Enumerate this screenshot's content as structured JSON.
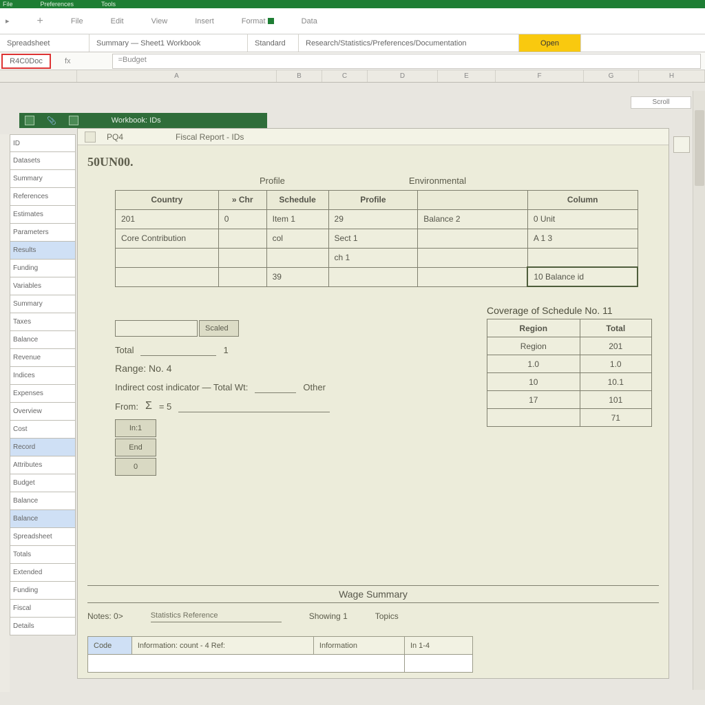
{
  "appbar": {
    "items": [
      "File",
      "Preferences",
      "Tools"
    ]
  },
  "menu": {
    "items": [
      "",
      "File",
      "Edit",
      "View",
      "Insert",
      "Format",
      "Data"
    ]
  },
  "tabs": {
    "items": [
      "Spreadsheet",
      "Summary — Sheet1   Workbook",
      "Standard",
      "Research/Statistics/Preferences/Documentation"
    ],
    "highlight": "Open"
  },
  "refbar": {
    "cell": "R4C0Doc",
    "formula": "=Budget"
  },
  "corner_label": "Scroll",
  "greenbar": {
    "title": "Workbook: IDs"
  },
  "sidebar": {
    "items": [
      {
        "label": "ID",
        "sel": false
      },
      {
        "label": "Datasets",
        "sel": false
      },
      {
        "label": "Summary",
        "sel": false
      },
      {
        "label": "References",
        "sel": false
      },
      {
        "label": "Estimates",
        "sel": false
      },
      {
        "label": "Parameters",
        "sel": false
      },
      {
        "label": "Results",
        "sel": true
      },
      {
        "label": "Funding",
        "sel": false
      },
      {
        "label": "Variables",
        "sel": false
      },
      {
        "label": "Summary",
        "sel": false
      },
      {
        "label": "Taxes",
        "sel": false
      },
      {
        "label": "Balance",
        "sel": false
      },
      {
        "label": "Revenue",
        "sel": false
      },
      {
        "label": "Indices",
        "sel": false
      },
      {
        "label": "Expenses",
        "sel": false
      },
      {
        "label": "Overview",
        "sel": false
      },
      {
        "label": "Cost",
        "sel": false
      },
      {
        "label": "Record",
        "sel": true
      },
      {
        "label": "Attributes",
        "sel": false
      },
      {
        "label": "Budget",
        "sel": false
      },
      {
        "label": "Balance",
        "sel": false
      },
      {
        "label": "Balance",
        "sel": true
      },
      {
        "label": "Spreadsheet",
        "sel": false
      },
      {
        "label": "Totals",
        "sel": false
      },
      {
        "label": "Extended",
        "sel": false
      },
      {
        "label": "Funding",
        "sel": false
      },
      {
        "label": "Fiscal",
        "sel": false
      },
      {
        "label": "Details",
        "sel": false
      }
    ]
  },
  "worksheet": {
    "title_parts": [
      "PQ4",
      "Fiscal Report - IDs"
    ],
    "bigno": "50UN00.",
    "section_left": "Profile",
    "section_right": "Environmental",
    "main_table": {
      "headers": [
        "Country",
        "» Chr",
        "Schedule",
        "Profile",
        "",
        "Column"
      ],
      "rows": [
        [
          "201",
          "0",
          "Item 1",
          "29",
          "Balance 2",
          "0    Unit"
        ],
        [
          "Core Contribution",
          "",
          "col",
          "Sect   1",
          "",
          "A     1      3"
        ],
        [
          "",
          "",
          "",
          "ch 1",
          "",
          ""
        ],
        [
          "",
          "",
          "39",
          "",
          "",
          "10   Balance  id"
        ]
      ]
    },
    "coverage": {
      "title": "Coverage of Schedule No. 11",
      "headers": [
        "Region",
        "Total"
      ],
      "rows": [
        [
          "Region",
          "201"
        ],
        [
          "1.0",
          "1.0"
        ],
        [
          "10",
          "10.1"
        ],
        [
          "17",
          "101"
        ],
        [
          "",
          "71"
        ]
      ]
    },
    "pair": {
      "left": "",
      "right": "Scaled"
    },
    "amount_label": "Total",
    "amount_val": "1",
    "range_label": "Range: No. 4",
    "indirect_label": "Indirect cost indicator — Total Wt:",
    "indirect_val": "Other",
    "from_label": "From:",
    "eq_label": "= 5",
    "boxes": [
      "In:1",
      "End",
      "0"
    ],
    "footer_title": "Wage Summary",
    "footer_row": [
      "Notes: 0>",
      "Statistics Reference",
      "Showing 1",
      "Topics"
    ],
    "foot_table": {
      "cells": [
        "Code",
        "Information: count - 4    Ref:",
        "Information",
        "In   1-4"
      ]
    }
  }
}
